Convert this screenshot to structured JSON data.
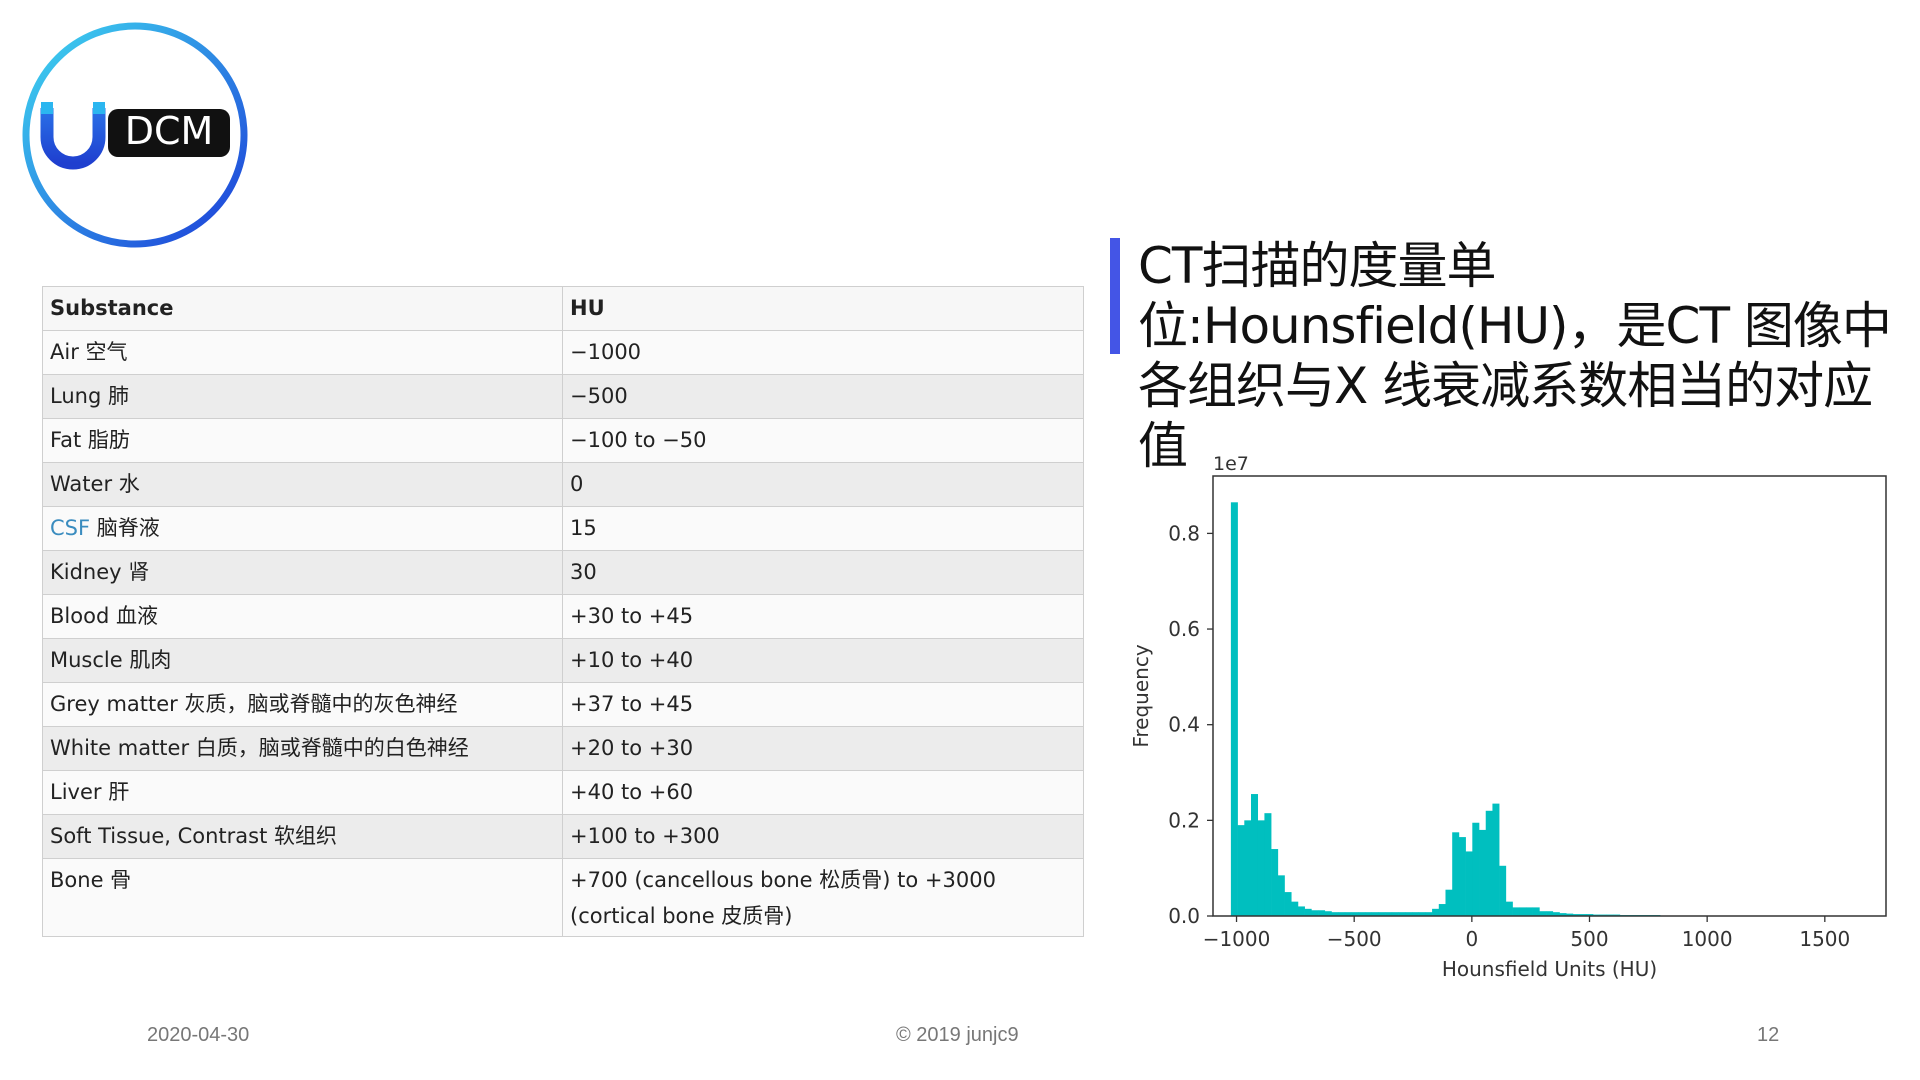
{
  "logo": {
    "text": "DCM"
  },
  "table": {
    "headers": [
      "Substance",
      "HU"
    ],
    "rows": [
      {
        "substance": "Air 空气",
        "hu": "−1000"
      },
      {
        "substance": "Lung 肺",
        "hu": "−500"
      },
      {
        "substance": "Fat 脂肪",
        "hu": "−100 to −50"
      },
      {
        "substance": "Water 水",
        "hu": "0"
      },
      {
        "substance_link": "CSF",
        "substance_rest": " 脑脊液",
        "hu": "15"
      },
      {
        "substance": "Kidney 肾",
        "hu": "30"
      },
      {
        "substance": "Blood 血液",
        "hu": "+30 to +45"
      },
      {
        "substance": "Muscle 肌肉",
        "hu": "+10 to +40"
      },
      {
        "substance": "Grey matter 灰质，脑或脊髓中的灰色神经",
        "hu": "+37 to +45"
      },
      {
        "substance": "White matter 白质，脑或脊髓中的白色神经",
        "hu": "+20 to +30"
      },
      {
        "substance": "Liver 肝",
        "hu": "+40 to +60"
      },
      {
        "substance": "Soft Tissue, Contrast 软组织",
        "hu": "+100 to +300"
      },
      {
        "substance": "Bone 骨",
        "hu": "+700 (cancellous bone 松质骨) to +3000 (cortical bone 皮质骨)"
      }
    ]
  },
  "title": {
    "text": "CT扫描的度量单位:Hounsfield(HU)，是CT 图像中各组织与X 线衰减系数相当的对应值"
  },
  "chart_data": {
    "type": "bar",
    "xlabel": "Hounsfield Units (HU)",
    "ylabel": "Frequency",
    "scale_label": "1e7",
    "xlim": [
      -1100,
      1760
    ],
    "ylim": [
      0,
      0.92
    ],
    "xticks": [
      -1000,
      -500,
      0,
      500,
      1000,
      1500
    ],
    "xtick_labels": [
      "−1000",
      "−500",
      "0",
      "500",
      "1000",
      "1500"
    ],
    "yticks": [
      0.0,
      0.2,
      0.4,
      0.6,
      0.8
    ],
    "ytick_labels": [
      "0.0",
      "0.2",
      "0.4",
      "0.6",
      "0.8"
    ],
    "bar_color": "#00bfbf",
    "bin_start": -1024,
    "bin_width": 28.5,
    "values": [
      0.865,
      0.19,
      0.2,
      0.255,
      0.2,
      0.215,
      0.14,
      0.085,
      0.05,
      0.03,
      0.02,
      0.015,
      0.012,
      0.012,
      0.01,
      0.008,
      0.008,
      0.008,
      0.008,
      0.008,
      0.008,
      0.008,
      0.008,
      0.008,
      0.008,
      0.008,
      0.008,
      0.008,
      0.008,
      0.008,
      0.015,
      0.025,
      0.055,
      0.175,
      0.165,
      0.135,
      0.195,
      0.18,
      0.22,
      0.235,
      0.105,
      0.03,
      0.018,
      0.018,
      0.018,
      0.018,
      0.01,
      0.01,
      0.008,
      0.006,
      0.005,
      0.004,
      0.004,
      0.004,
      0.003,
      0.003,
      0.003,
      0.003,
      0.002,
      0.002,
      0.002,
      0.002,
      0.002,
      0.002,
      0.001
    ]
  },
  "footer": {
    "date": "2020-04-30",
    "copyright": "© 2019 junjc9",
    "page": "12"
  }
}
